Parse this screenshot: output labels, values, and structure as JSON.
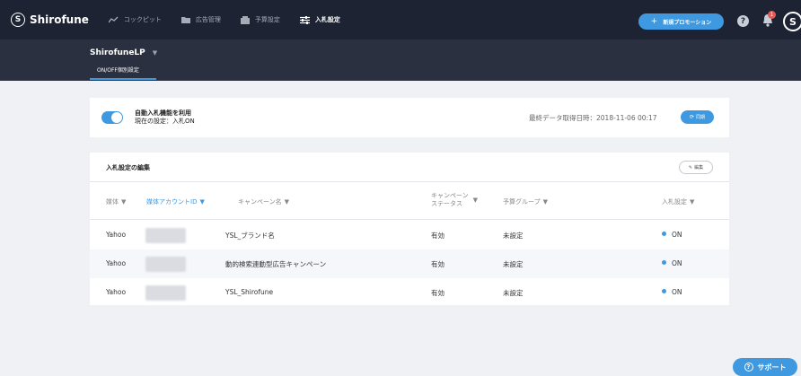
{
  "nav": {
    "brand": "Shirofune",
    "items": [
      {
        "label": "コックピット",
        "icon": "chart-line-icon"
      },
      {
        "label": "広告管理",
        "icon": "folder-icon"
      },
      {
        "label": "予算設定",
        "icon": "wallet-icon"
      },
      {
        "label": "入札設定",
        "icon": "sliders-icon",
        "active": true
      }
    ],
    "promo_button": "新規プロモーション",
    "notification_count": "1"
  },
  "subheader": {
    "project": "ShirofuneLP",
    "tab": "ON/OFF個別設定"
  },
  "auto_bid": {
    "title": "自動入札機能を利用",
    "status": "現在の設定：入札ON",
    "last_fetch": "最終データ取得日時：2018-11-06 00:17",
    "sync_button": "同期"
  },
  "bid_table": {
    "title": "入札設定の編集",
    "edit_button": "編集",
    "headers": {
      "media": "媒体",
      "account_id": "媒体アカウントID",
      "campaign": "キャンペーン名",
      "status_line1": "キャンペーン",
      "status_line2": "ステータス",
      "budget_group": "予算グループ",
      "bid": "入札設定"
    },
    "rows": [
      {
        "media": "Yahoo",
        "campaign": "YSL_ブランド名",
        "status": "有効",
        "budget_group": "未設定",
        "bid": "ON"
      },
      {
        "media": "Yahoo",
        "campaign": "動的検索連動型広告キャンペーン",
        "status": "有効",
        "budget_group": "未設定",
        "bid": "ON"
      },
      {
        "media": "Yahoo",
        "campaign": "YSL_Shirofune",
        "status": "有効",
        "budget_group": "未設定",
        "bid": "ON"
      }
    ]
  },
  "support_button": "サポート",
  "colors": {
    "accent": "#3e99e0",
    "nav_bg": "#1d2333",
    "badge": "#e25a5a"
  }
}
